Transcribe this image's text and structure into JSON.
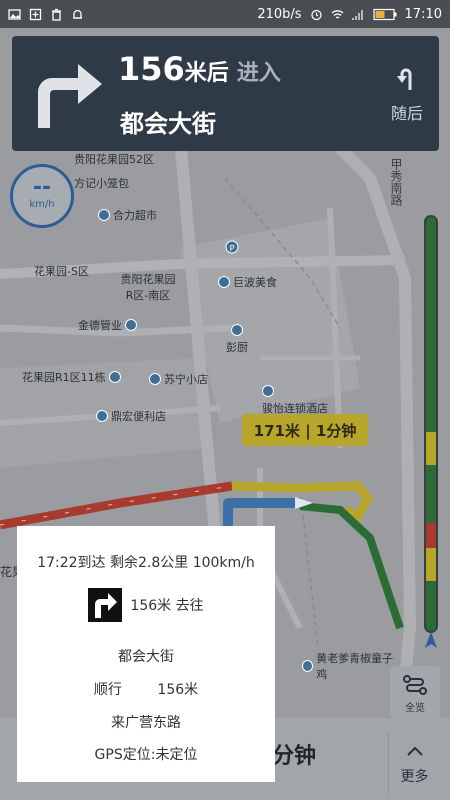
{
  "status_bar": {
    "network_speed": "210b/s",
    "time": "17:10",
    "icons": [
      "image-icon",
      "plus-box-icon",
      "trash-icon",
      "bell-icon",
      "alarm-icon",
      "wifi-icon",
      "signal-icon",
      "battery-icon"
    ]
  },
  "banner": {
    "distance": "156",
    "unit": "米后",
    "action": "进入",
    "road": "都会大街",
    "next_label": "随后"
  },
  "speed": {
    "value": "--",
    "unit": "km/h"
  },
  "map": {
    "pois": [
      "贵阳花果园52区",
      "方记小笼包",
      "合力超市",
      "花果园-S区",
      "贵阳花果园R区-南区",
      "巨波美食",
      "金德管业",
      "彭厨",
      "花果园R1区11栋",
      "苏宁小店",
      "骏怡连锁酒店",
      "鼎宏便利店",
      "黄老爹青椒童子鸡",
      "甲秀南路",
      "花果"
    ],
    "route_callout": "171米 | 1分钟"
  },
  "overview_button": {
    "label": "全览"
  },
  "bottom_bar": {
    "eta_text": "分钟",
    "more_label": "更多"
  },
  "dialog": {
    "summary": "17:22到达   剩余2.8公里   100km/h",
    "turn_text": "156米   去往",
    "road": "都会大街",
    "follow": "顺行        156米",
    "next_road": "来广营东路",
    "gps": "GPS定位:未定位"
  },
  "colors": {
    "banner_bg": "#2f3a47",
    "route_blue": "#3d6fa8",
    "route_red": "#a83a2e",
    "route_yellow": "#b8a52c",
    "route_green": "#2a6b36",
    "speed_blue": "#2c5d99"
  },
  "traffic_bar": [
    {
      "color": "#2a6b36",
      "start": 0.0,
      "end": 0.52
    },
    {
      "color": "#b8a52c",
      "start": 0.52,
      "end": 0.6
    },
    {
      "color": "#2a6b36",
      "start": 0.6,
      "end": 0.74
    },
    {
      "color": "#a83a2e",
      "start": 0.74,
      "end": 0.8
    },
    {
      "color": "#b8a52c",
      "start": 0.8,
      "end": 0.88
    },
    {
      "color": "#2a6b36",
      "start": 0.88,
      "end": 1.0
    }
  ]
}
